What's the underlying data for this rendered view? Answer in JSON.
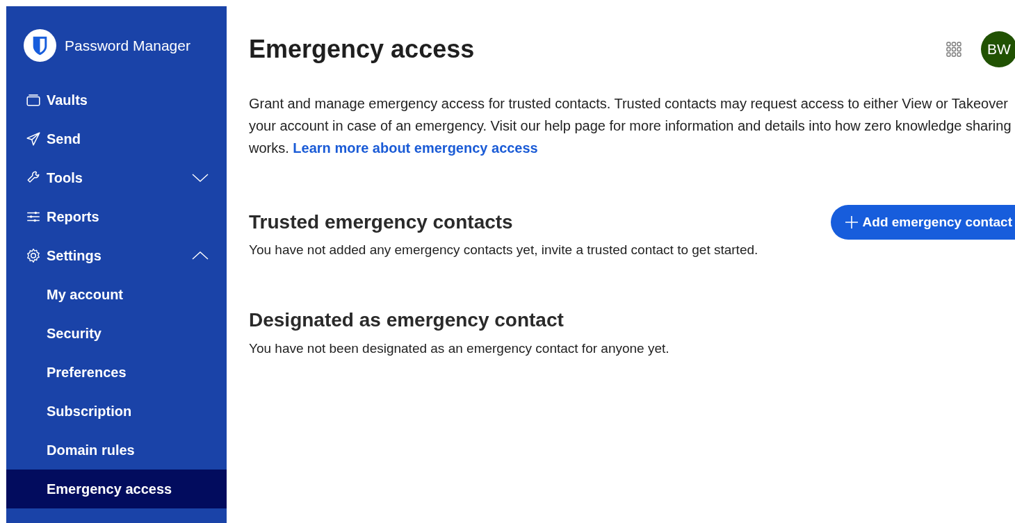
{
  "sidebar": {
    "product": "Password Manager",
    "items": [
      {
        "label": "Vaults",
        "kind": "link"
      },
      {
        "label": "Send",
        "kind": "link"
      },
      {
        "label": "Tools",
        "kind": "group",
        "expanded": false
      },
      {
        "label": "Reports",
        "kind": "link"
      },
      {
        "label": "Settings",
        "kind": "group",
        "expanded": true,
        "children": [
          {
            "label": "My account",
            "selected": false
          },
          {
            "label": "Security",
            "selected": false
          },
          {
            "label": "Preferences",
            "selected": false
          },
          {
            "label": "Subscription",
            "selected": false
          },
          {
            "label": "Domain rules",
            "selected": false
          },
          {
            "label": "Emergency access",
            "selected": true
          }
        ]
      }
    ]
  },
  "header": {
    "title": "Emergency access",
    "avatar": "BW"
  },
  "intro": {
    "text": "Grant and manage emergency access for trusted contacts. Trusted contacts may request access to either View or Takeover your account in case of an emergency. Visit our help page for more information and details into how zero knowledge sharing works.",
    "link": "Learn more about emergency access"
  },
  "sections": [
    {
      "title": "Trusted emergency contacts",
      "button": "Add emergency contact",
      "empty_text": "You have not added any emergency contacts yet, invite a trusted contact to get started."
    },
    {
      "title": "Designated as emergency contact",
      "empty_text": "You have not been designated as an emergency contact for anyone yet."
    }
  ]
}
